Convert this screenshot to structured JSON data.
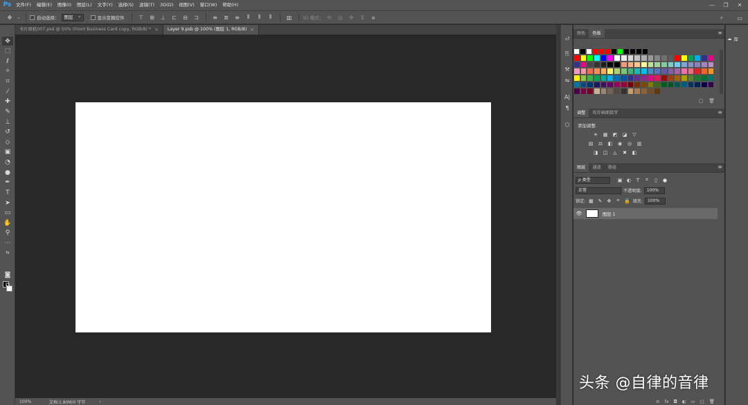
{
  "app": {
    "logo": "Ps",
    "menu": [
      "文件(F)",
      "编辑(E)",
      "图像(I)",
      "图层(L)",
      "文字(Y)",
      "选择(S)",
      "滤镜(T)",
      "3D(D)",
      "视图(V)",
      "窗口(W)",
      "帮助(H)"
    ],
    "window_controls": [
      "—",
      "❐",
      "✕"
    ]
  },
  "options_bar": {
    "auto_select_label": "自动选择：",
    "auto_select_value": "图层",
    "show_transform_label": "显示变换控件",
    "mode_3d_label": "3D 模式："
  },
  "documents": {
    "tabs": [
      {
        "label": "卡片样机007.psd @ 50% (Front Business Card copy, RGB/8) *",
        "active": false
      },
      {
        "label": "Layer 9.psb @ 100% (图层 1, RGB/8)",
        "active": true
      }
    ],
    "close_glyph": "×"
  },
  "status": {
    "zoom": "100%",
    "doc_info": "文档:1.80M/0 字节",
    "arrow": "›"
  },
  "swatches_panel": {
    "tabs": [
      "颜色",
      "色板"
    ],
    "active_tab": 1,
    "recent": [
      "#ffffff",
      "#000000",
      "#ffffff",
      "#ff0000",
      "#ff0000",
      "#ff0000",
      "#000000",
      "#00ff00",
      "#000000",
      "#000000",
      "#000000",
      "#000000"
    ],
    "grid": [
      "#ff0000",
      "#ffff00",
      "#00ff00",
      "#00ffff",
      "#0000ff",
      "#ff00ff",
      "#ffffff",
      "#ebebeb",
      "#d6d6d6",
      "#c2c2c2",
      "#adadad",
      "#999999",
      "#858585",
      "#707070",
      "#5c5c5c",
      "#ff0000",
      "#ffff00",
      "#00a651",
      "#00aeef",
      "#2e3192",
      "#ec008c",
      "#2e3192",
      "#ec008c",
      "#474747",
      "#333333",
      "#1f1f1f",
      "#0a0a0a",
      "#000000",
      "#f7977a",
      "#f9ad81",
      "#fdc68a",
      "#fff79a",
      "#c4df9b",
      "#a2d39c",
      "#82ca9d",
      "#7bcdc8",
      "#6ecff6",
      "#7ea7d8",
      "#8493ca",
      "#8882be",
      "#a187be",
      "#bc8dbf",
      "#f49ac2",
      "#f6989d",
      "#f26c4f",
      "#f68e55",
      "#fbaf5c",
      "#fff467",
      "#acd372",
      "#7cc576",
      "#3bb878",
      "#1abbb4",
      "#00bff3",
      "#438ccb",
      "#5574b9",
      "#605ca8",
      "#855fa8",
      "#a763a8",
      "#f06ea9",
      "#f26d7d",
      "#ed1c24",
      "#f26522",
      "#f7941d",
      "#fff200",
      "#8dc63f",
      "#39b54a",
      "#00a651",
      "#00a99d",
      "#00aeef",
      "#0072bc",
      "#0054a6",
      "#2e3192",
      "#662d91",
      "#92278f",
      "#ec008c",
      "#ed145b",
      "#9e0b0f",
      "#a0410d",
      "#a36209",
      "#aba000",
      "#598527",
      "#1a7b30",
      "#007236",
      "#00746b",
      "#0076a3",
      "#004b80",
      "#003471",
      "#1b1464",
      "#440e62",
      "#630460",
      "#9e005d",
      "#9e0039",
      "#790000",
      "#7b2e00",
      "#7d4900",
      "#827b00",
      "#406618",
      "#005e20",
      "#005826",
      "#005952",
      "#005b7f",
      "#003663",
      "#002157",
      "#0d004c",
      "#32004b",
      "#4b0049",
      "#7b0046",
      "#7a0026",
      "#c7b299",
      "#998675",
      "#736357",
      "#534741",
      "#37302d",
      "#c69c6d",
      "#a67c52",
      "#8c6239",
      "#754c24",
      "#603913"
    ]
  },
  "adjustments_panel": {
    "tabs": [
      "调整",
      "库存画面数字"
    ],
    "title": "添加调整",
    "row1": [
      "☀",
      "▦",
      "◩",
      "◪",
      "▽"
    ],
    "row2": [
      "▤",
      "⚖",
      "◧",
      "◉",
      "◎",
      "▥"
    ],
    "row3": [
      "◨",
      "◫",
      "◬",
      "✖",
      "◧"
    ]
  },
  "layers_panel": {
    "tabs": [
      "图层",
      "通道",
      "路径"
    ],
    "filter_label": "ρ 类型",
    "blend_mode": "正常",
    "opacity_label": "不透明度:",
    "opacity_value": "100%",
    "lock_label": "锁定:",
    "fill_label": "填充:",
    "fill_value": "100%",
    "layers": [
      {
        "name": "图层 1"
      }
    ],
    "footer_icons": [
      "⊝",
      "fx",
      "◘",
      "◐",
      "▭",
      "▢",
      "🗑"
    ]
  },
  "far_right": {
    "lib_label": "库"
  },
  "watermark": "头条 @自律的音律"
}
